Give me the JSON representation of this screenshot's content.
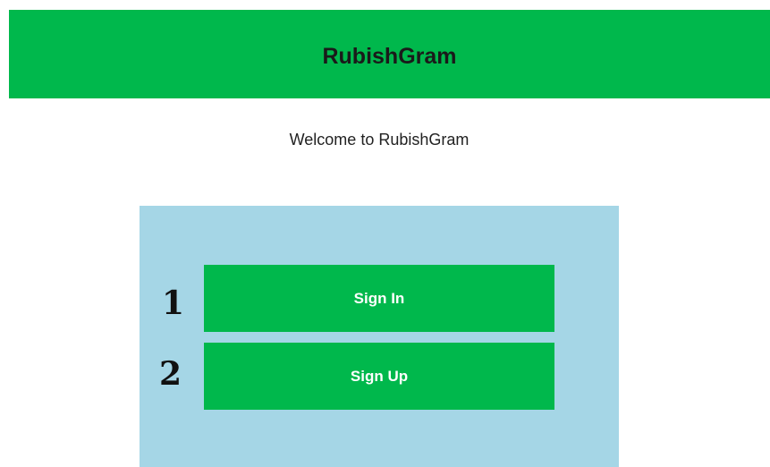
{
  "header": {
    "title": "RubishGram",
    "color": "#00b84c"
  },
  "welcome": {
    "text": "Welcome to RubishGram"
  },
  "panel": {
    "color": "#a5d6e6",
    "options": [
      {
        "number": "1",
        "label": "Sign In"
      },
      {
        "number": "2",
        "label": "Sign Up"
      }
    ]
  }
}
